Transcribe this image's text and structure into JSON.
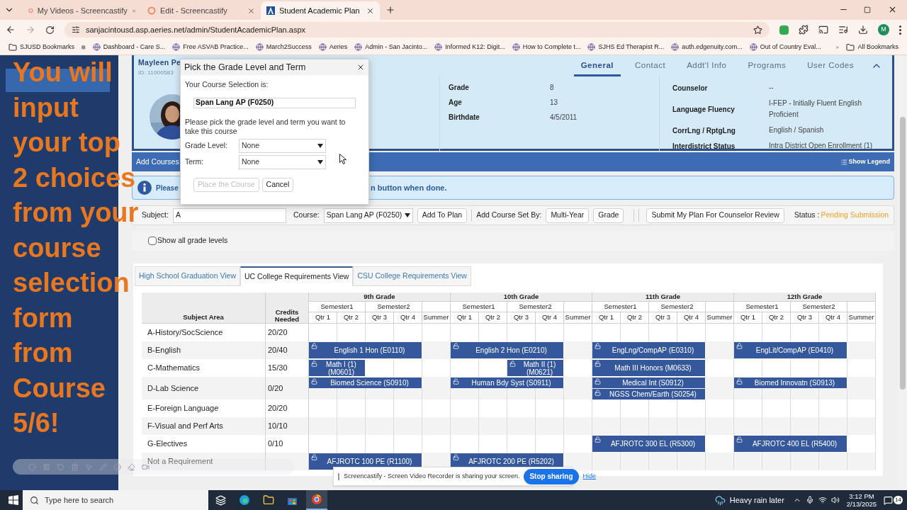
{
  "browser": {
    "tabs": [
      {
        "title": "My Videos - Screencastify",
        "selected": false
      },
      {
        "title": "Edit - Screencastify",
        "selected": false
      },
      {
        "title": "Student Academic Plan",
        "selected": true
      }
    ],
    "address": "sanjacintousd.asp.aeries.net/admin/StudentAcademicPlan.aspx",
    "profile_initial": "M",
    "bookmarks": [
      {
        "label": "SJUSD Bookmarks",
        "kind": "folder"
      },
      {
        "label": "Dashboard - Care S...",
        "kind": "site"
      },
      {
        "label": "Free ASVAB Practice...",
        "kind": "site"
      },
      {
        "label": "March2Success",
        "kind": "site"
      },
      {
        "label": "Aeries",
        "kind": "site"
      },
      {
        "label": "Admin - San Jacinto...",
        "kind": "site"
      },
      {
        "label": "Informed K12: Digit...",
        "kind": "site"
      },
      {
        "label": "How to Complete t...",
        "kind": "site"
      },
      {
        "label": "SJHS Ed Therapist R...",
        "kind": "site"
      },
      {
        "label": "auth.edgenuity.com...",
        "kind": "site"
      },
      {
        "label": "Out of Country Eval...",
        "kind": "site"
      }
    ],
    "all_bookmarks": "All Bookmarks"
  },
  "overlay_lines": [
    "You will",
    "input",
    "your top",
    "2 choices",
    "from your",
    "course",
    "selection",
    "form",
    "from",
    "Course",
    "5/6!"
  ],
  "sidebar": {
    "items": [
      {
        "selected": true
      },
      {
        "selected": false
      }
    ]
  },
  "student": {
    "name": "Mayleen Pe",
    "id": "ID: 11000583",
    "tabs": [
      {
        "label": "General",
        "selected": true
      },
      {
        "label": "Contact",
        "selected": false
      },
      {
        "label": "Addt'l Info",
        "selected": false
      },
      {
        "label": "Programs",
        "selected": false
      },
      {
        "label": "User Codes",
        "selected": false
      }
    ],
    "details": [
      {
        "label": "Grade",
        "value": "8"
      },
      {
        "label": "Age",
        "value": "13"
      },
      {
        "label": "Birthdate",
        "value": "4/5/2011"
      }
    ],
    "details_right": [
      {
        "label": "Counselor",
        "value": "--"
      },
      {
        "label": "Language Fluency",
        "value": "I-FEP - Initially Fluent English Proficient"
      },
      {
        "label": "CorrLng / RptgLng",
        "value": "English / Spanish"
      },
      {
        "label": "Interdistrict Status",
        "value": "Intra District Open Enrollment (1)"
      }
    ]
  },
  "add_courses": {
    "title": "Add Courses",
    "legend": "Show Legend"
  },
  "info": {
    "start": "Please",
    "end": "n button when done."
  },
  "toolbar": {
    "subject_label": "Subject:",
    "subject_value": "A",
    "course_label": "Course:",
    "course_value": "Span Lang AP (F0250)",
    "add_button": "Add To Plan",
    "set_label": "Add Course Set By:",
    "set_buttons": [
      "Multi-Year",
      "Grade"
    ],
    "submit_button": "Submit My Plan For Counselor Review",
    "status_label": "Status :",
    "status_value": "Pending Submission"
  },
  "show_all": {
    "label": "Show all grade levels",
    "checked": false
  },
  "view_tabs": [
    {
      "label": "High School Graduation View",
      "selected": false
    },
    {
      "label": "UC College Requirements View",
      "selected": true
    },
    {
      "label": "CSU College Requirements View",
      "selected": false
    }
  ],
  "plan": {
    "subject_heading": "Subject Area",
    "credits_heading": "Credits Needed",
    "grades": [
      {
        "label": "9th Grade",
        "semesters": [
          "Semester1",
          "Semester2"
        ],
        "quarters": [
          "Qtr 1",
          "Qtr 2",
          "Qtr 3",
          "Qtr 4"
        ],
        "summer": "Summer"
      },
      {
        "label": "10th Grade",
        "semesters": [
          "Semester1",
          "Semester2"
        ],
        "quarters": [
          "Qtr 1",
          "Qtr 2",
          "Qtr 3",
          "Qtr 4"
        ],
        "summer": "Summer"
      },
      {
        "label": "11th Grade",
        "semesters": [
          "Semester1",
          "Semester2"
        ],
        "quarters": [
          "Qtr 1",
          "Qtr 2",
          "Qtr 3",
          "Qtr 4"
        ],
        "summer": "Summer"
      },
      {
        "label": "12th Grade",
        "semesters": [
          "Semester1",
          "Semester2"
        ],
        "quarters": [
          "Qtr 1",
          "Qtr 2",
          "Qtr 3",
          "Qtr 4"
        ],
        "summer": "Summer"
      }
    ],
    "rows": [
      {
        "subject": "A-History/SocScience",
        "credits": "20/20",
        "tracks": []
      },
      {
        "subject": "B-English",
        "credits": "20/40",
        "tracks": [
          {
            "slots": [
              {
                "kind": "year",
                "label": "English 1 Hon (E0110)"
              },
              {
                "kind": "year",
                "label": "English 2 Hon (E0210)"
              },
              {
                "kind": "year",
                "label": "EngLng/CompAP (E0310)"
              },
              {
                "kind": "year",
                "label": "EngLit/CompAP (E0410)"
              }
            ]
          }
        ]
      },
      {
        "subject": "C-Mathematics",
        "credits": "15/30",
        "tracks": [
          {
            "slots": [
              {
                "kind": "semester1",
                "label": "Math I (1) (M0601)"
              },
              {
                "kind": "semester2",
                "label": "Math II (1) (M0621)"
              },
              {
                "kind": "year",
                "label": "Math III Honors (M0633)"
              },
              {
                "kind": "empty"
              }
            ]
          }
        ]
      },
      {
        "subject": "D-Lab Science",
        "credits": "0/20",
        "tracks": [
          {
            "slots": [
              {
                "kind": "year",
                "label": "Biomed Science (S0910)"
              },
              {
                "kind": "year",
                "label": "Human Bdy Syst (S0911)"
              },
              {
                "kind": "year",
                "label": "Medical Int (S0912)"
              },
              {
                "kind": "year",
                "label": "Biomed Innovatn (S0913)"
              }
            ]
          },
          {
            "slots": [
              {
                "kind": "empty"
              },
              {
                "kind": "empty"
              },
              {
                "kind": "year",
                "label": "NGSS Chem/Earth (S0254)"
              },
              {
                "kind": "empty"
              }
            ]
          }
        ]
      },
      {
        "subject": "E-Foreign Language",
        "credits": "20/20",
        "tracks": []
      },
      {
        "subject": "F-Visual and Perf Arts",
        "credits": "10/10",
        "tracks": []
      },
      {
        "subject": "G-Electives",
        "credits": "0/10",
        "tracks": [
          {
            "slots": [
              {
                "kind": "empty"
              },
              {
                "kind": "empty"
              },
              {
                "kind": "year",
                "label": "AFJROTC 300 EL (R5300)"
              },
              {
                "kind": "year",
                "label": "AFJROTC 400 EL (R5400)"
              }
            ]
          }
        ]
      },
      {
        "subject": "Not a Requirement",
        "credits": "",
        "tracks": [
          {
            "slots": [
              {
                "kind": "year",
                "label": "AFJROTC 100 PE (R1100)"
              },
              {
                "kind": "year",
                "label": "AFJROTC 200 PE (R5202)"
              },
              {
                "kind": "empty"
              },
              {
                "kind": "empty"
              }
            ]
          }
        ]
      }
    ]
  },
  "dialog": {
    "title": "Pick the Grade Level and Term",
    "course_label": "Your Course Selection is:",
    "course": "Span Lang AP (F0250)",
    "instructions": "Please pick the grade level and term you want to take this course",
    "fields": [
      {
        "label": "Grade Level:",
        "value": "None"
      },
      {
        "label": "Term:",
        "value": "None"
      }
    ],
    "buttons": [
      {
        "label": "Place the Course",
        "disabled": true
      },
      {
        "label": "Cancel",
        "disabled": false
      }
    ]
  },
  "share_bar": {
    "message": "Screencastify - Screen Video Recorder is sharing your screen.",
    "stop": "Stop sharing",
    "hide": "Hide"
  },
  "taskbar": {
    "search_placeholder": "Type here to search",
    "weather": "Heavy rain later",
    "time": "3:12 PM",
    "date": "2/13/2025",
    "notifications": "14"
  }
}
